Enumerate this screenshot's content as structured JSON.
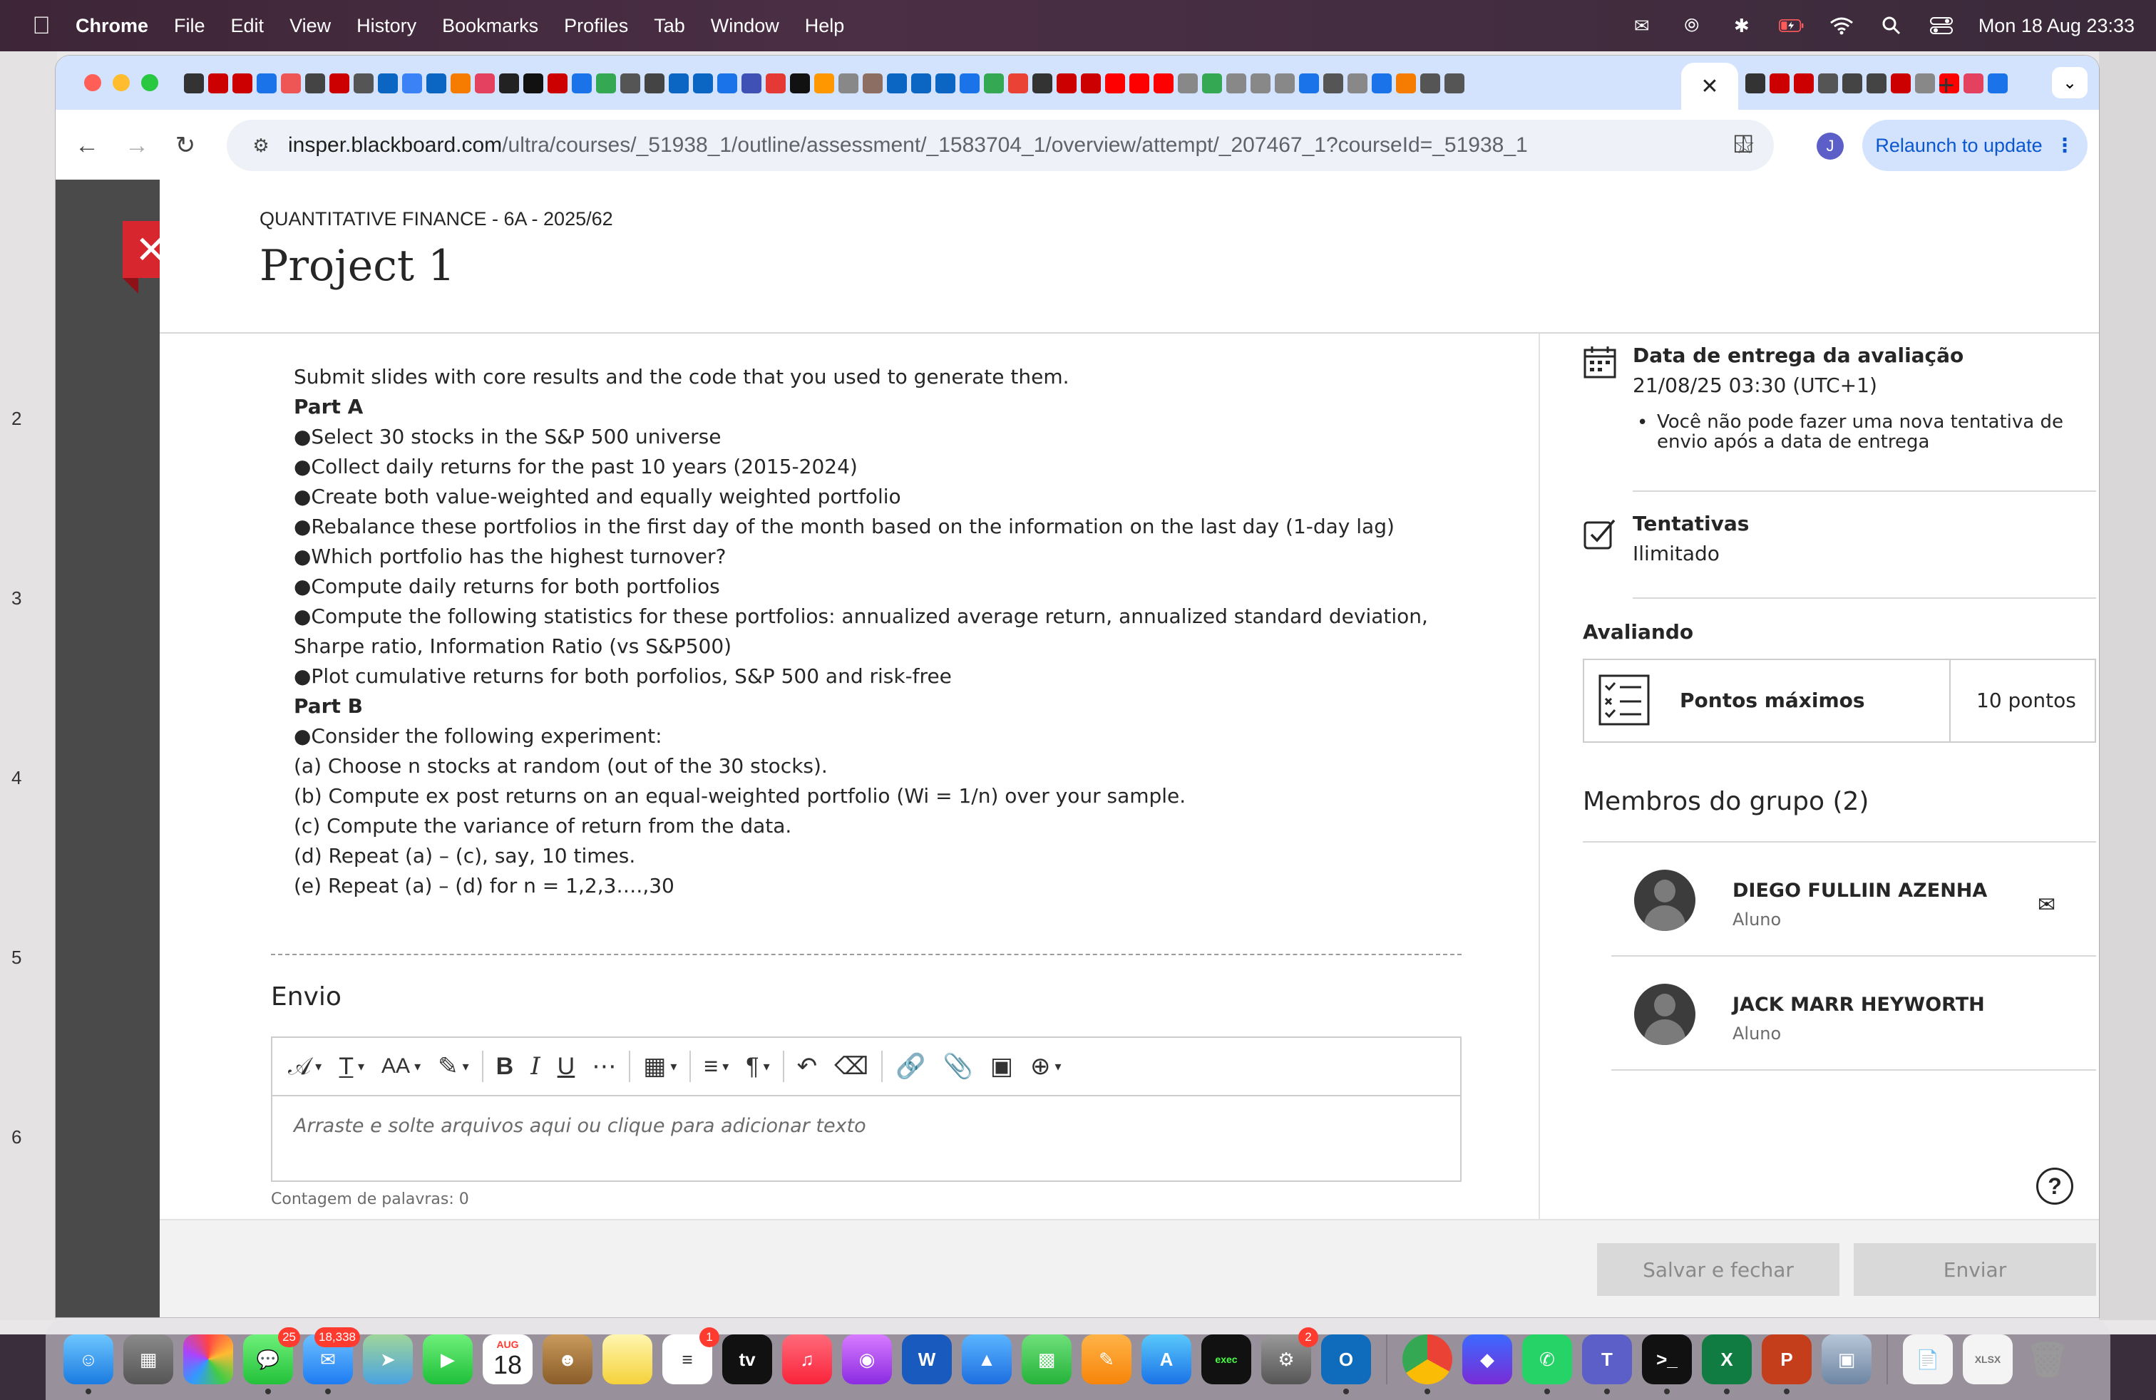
{
  "menubar": {
    "app_name": "Chrome",
    "items": [
      "File",
      "Edit",
      "View",
      "History",
      "Bookmarks",
      "Profiles",
      "Tab",
      "Window",
      "Help"
    ],
    "clock": "Mon 18 Aug  23:33"
  },
  "background_app": {
    "slide_numbers": [
      "2",
      "3",
      "4",
      "5",
      "6"
    ]
  },
  "browser": {
    "url_domain": "insper.blackboard.com",
    "url_path": "/ultra/courses/_51938_1/outline/assessment/_1583704_1/overview/attempt/_207467_1?courseId=_51938_1",
    "relaunch_label": "Relaunch to update",
    "profile_initial": "J",
    "active_tab_close": "✕",
    "new_tab": "+"
  },
  "assessment": {
    "course": "QUANTITATIVE FINANCE - 6A - 2025/62",
    "title": "Project 1",
    "instructions": [
      {
        "text": "Submit slides with core results and the code that you used to generate them.",
        "bold": false
      },
      {
        "text": "Part A",
        "bold": true
      },
      {
        "text": "●Select 30 stocks in the S&P 500 universe",
        "bold": false
      },
      {
        "text": "●Collect daily returns for the past 10 years (2015-2024)",
        "bold": false
      },
      {
        "text": "●Create both value-weighted and equally weighted portfolio",
        "bold": false
      },
      {
        "text": "●Rebalance these portfolios in the first day of the month based on the information on the last day (1-day lag)",
        "bold": false
      },
      {
        "text": "●Which portfolio has the highest turnover?",
        "bold": false
      },
      {
        "text": "●Compute daily returns for both portfolios",
        "bold": false
      },
      {
        "text": "●Compute the following statistics for these portfolios: annualized average return, annualized standard deviation, Sharpe ratio, Information Ratio (vs S&P500)",
        "bold": false
      },
      {
        "text": "●Plot cumulative returns for both porfolios, S&P 500 and risk-free",
        "bold": false
      },
      {
        "text": "Part B",
        "bold": true
      },
      {
        "text": "●Consider the following experiment:",
        "bold": false
      },
      {
        "text": "(a) Choose n stocks at random (out of the 30 stocks).",
        "bold": false
      },
      {
        "text": "(b) Compute ex post returns on an equal-weighted portfolio (Wi = 1/n) over your sample.",
        "bold": false
      },
      {
        "text": "(c) Compute the variance of return from the data.",
        "bold": false
      },
      {
        "text": "(d) Repeat (a) – (c), say, 10 times.",
        "bold": false
      },
      {
        "text": "(e) Repeat (a) – (d) for n = 1,2,3….,30",
        "bold": false
      }
    ],
    "submission": {
      "heading": "Envio",
      "placeholder": "Arraste e solte arquivos aqui ou clique para adicionar texto",
      "word_count": "Contagem de palavras: 0"
    },
    "sidebar": {
      "due_label": "Data de entrega da avaliação",
      "due_value": "21/08/25 03:30 (UTC+1)",
      "due_note": "Você não pode fazer uma nova tentativa de envio após a data de entrega",
      "attempts_label": "Tentativas",
      "attempts_value": "Ilimitado",
      "grading_label": "Avaliando",
      "max_points_label": "Pontos máximos",
      "max_points_value": "10 pontos",
      "members_heading": "Membros do grupo (2)",
      "members": [
        {
          "name": "DIEGO FULLIIN AZENHA",
          "role": "Aluno"
        },
        {
          "name": "JACK MARR HEYWORTH",
          "role": "Aluno"
        }
      ]
    },
    "footer": {
      "save_close": "Salvar e fechar",
      "submit": "Enviar"
    }
  },
  "dock": {
    "badges": {
      "messages": "25",
      "mail": "18,338",
      "reminders": "1",
      "settings": "2"
    },
    "calendar_month": "AUG",
    "calendar_day": "18"
  },
  "colors": {
    "close_red": "#d7262e",
    "chrome_tab_blue": "#d3e3fd",
    "relaunch_text": "#0b57d0"
  }
}
